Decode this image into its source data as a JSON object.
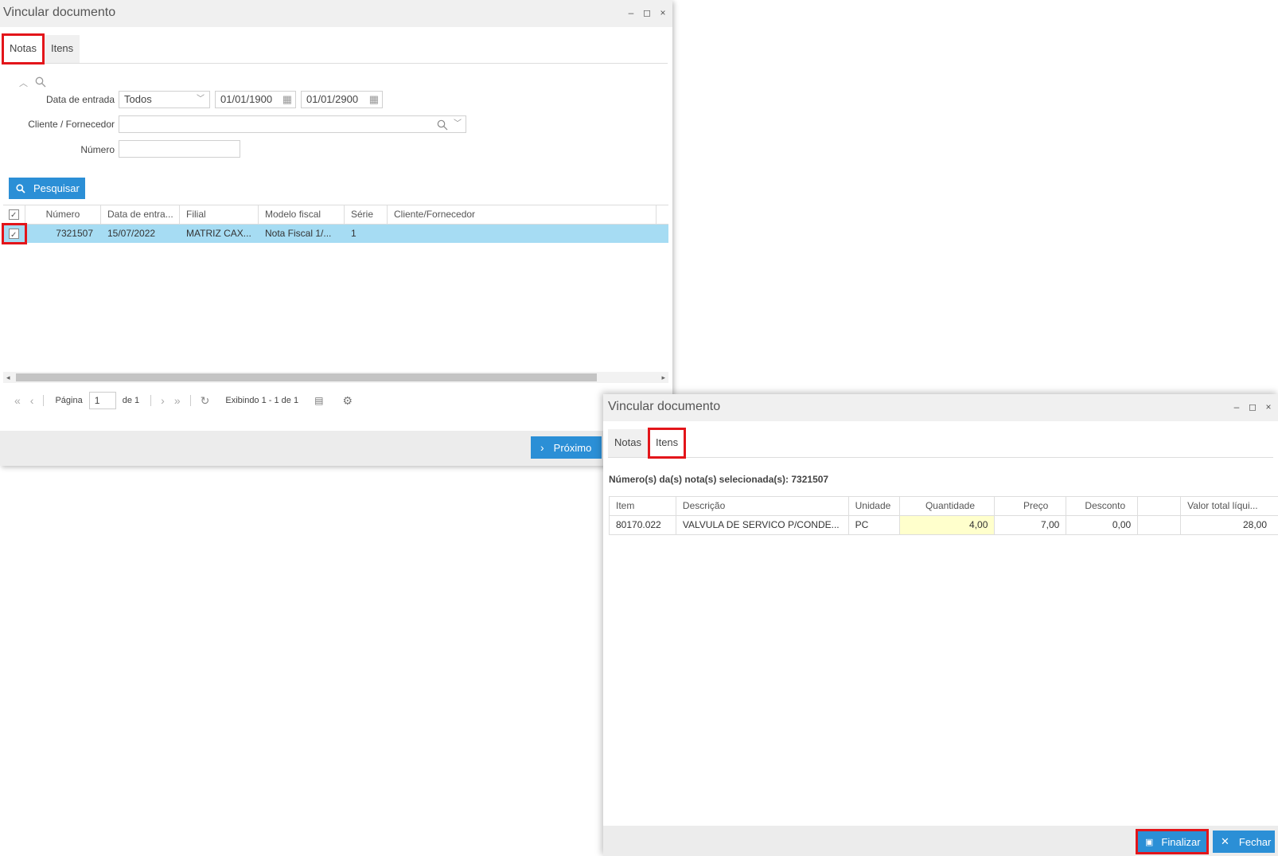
{
  "window1": {
    "title": "Vincular documento",
    "controls": {
      "minimize": "–",
      "maximize": "◻",
      "close": "×"
    },
    "tabs": [
      {
        "label": "Notas"
      },
      {
        "label": "Itens"
      }
    ],
    "filters": {
      "data_entrada_label": "Data de entrada",
      "data_entrada_option": "Todos",
      "date_from": "01/01/1900",
      "date_to": "01/01/2900",
      "cliente_label": "Cliente / Fornecedor",
      "cliente_value": "",
      "numero_label": "Número",
      "numero_value": ""
    },
    "search_button": "Pesquisar",
    "grid": {
      "columns": [
        "Número",
        "Data de entra...",
        "Filial",
        "Modelo fiscal",
        "Série",
        "Cliente/Fornecedor"
      ],
      "rows": [
        {
          "numero": "7321507",
          "data": "15/07/2022",
          "filial": "MATRIZ CAX...",
          "modelo": "Nota Fiscal 1/...",
          "serie": "1",
          "cliente": ""
        }
      ]
    },
    "pager": {
      "page_label": "Página",
      "page_value": "1",
      "of_label": "de 1",
      "showing": "Exibindo 1 - 1 de 1"
    },
    "next_button": "Próximo"
  },
  "window2": {
    "title": "Vincular documento",
    "controls": {
      "minimize": "–",
      "maximize": "◻",
      "close": "×"
    },
    "tabs": [
      {
        "label": "Notas"
      },
      {
        "label": "Itens"
      }
    ],
    "selected_notes": "Número(s) da(s) nota(s) selecionada(s): 7321507",
    "grid": {
      "columns": [
        "Item",
        "Descrição",
        "Unidade",
        "Quantidade",
        "Preço",
        "Desconto",
        "",
        "Valor total líqui..."
      ],
      "rows": [
        {
          "item": "80170.022",
          "descricao": "VALVULA DE SERVICO P/CONDE...",
          "unidade": "PC",
          "quantidade": "4,00",
          "preco": "7,00",
          "desconto": "0,00",
          "extra": "",
          "valor": "28,00"
        }
      ]
    },
    "finalize_button": "Finalizar",
    "close_button": "Fechar"
  },
  "colors": {
    "accent": "#2b8fd6",
    "highlight": "#e3151a",
    "selected_row": "#a6dcf3",
    "qty_cell": "#ffffcc"
  }
}
